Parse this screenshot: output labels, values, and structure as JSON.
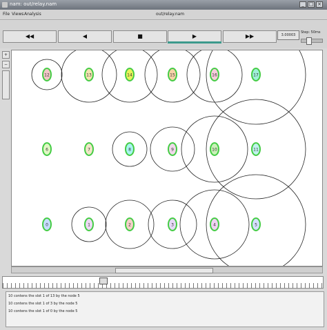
{
  "window": {
    "title": "nam: out/relay.nam"
  },
  "menu": {
    "items": [
      "File",
      "Views",
      "Analysis"
    ],
    "filename": "out/relay.nam"
  },
  "playback": {
    "buttons": [
      {
        "id": "rewind",
        "glyph": "◀◀"
      },
      {
        "id": "back",
        "glyph": "◀"
      },
      {
        "id": "stop",
        "glyph": "■"
      },
      {
        "id": "play",
        "glyph": "▶"
      },
      {
        "id": "forward",
        "glyph": "▶▶"
      }
    ],
    "time": "3.00003",
    "step_label": "Step: 50ms"
  },
  "colors": {
    "accent": "#3c9a8c",
    "canvas": "#ffffff"
  },
  "nodes": [
    {
      "label": "12",
      "fill": "#f2c6c6",
      "ring": "#44cc44"
    },
    {
      "label": "13",
      "fill": "#f3e4b0",
      "ring": "#44cc44"
    },
    {
      "label": "14",
      "fill": "#e8f25a",
      "ring": "#44cc44"
    },
    {
      "label": "15",
      "fill": "#f7d3a8",
      "ring": "#44cc44"
    },
    {
      "label": "16",
      "fill": "#f7cddc",
      "ring": "#44cc44"
    },
    {
      "label": "17",
      "fill": "#9ff0d8",
      "ring": "#44cc44"
    },
    {
      "label": "6",
      "fill": "#e0f7c4",
      "ring": "#44cc44"
    },
    {
      "label": "7",
      "fill": "#f0e6c8",
      "ring": "#44cc44"
    },
    {
      "label": "8",
      "fill": "#a8f4f0",
      "ring": "#44cc44"
    },
    {
      "label": "9",
      "fill": "#f0d8ea",
      "ring": "#44cc44"
    },
    {
      "label": "10",
      "fill": "#c9f1b8",
      "ring": "#44cc44"
    },
    {
      "label": "11",
      "fill": "#bff2ec",
      "ring": "#44cc44"
    },
    {
      "label": "0",
      "fill": "#c6dcff",
      "ring": "#44cc44"
    },
    {
      "label": "1",
      "fill": "#eed8f5",
      "ring": "#44cc44"
    },
    {
      "label": "2",
      "fill": "#f5d0c8",
      "ring": "#44cc44"
    },
    {
      "label": "3",
      "fill": "#e6d8f7",
      "ring": "#44cc44"
    },
    {
      "label": "4",
      "fill": "#f0d2f2",
      "ring": "#44cc44"
    },
    {
      "label": "5",
      "fill": "#d4e0ff",
      "ring": "#44cc44"
    }
  ],
  "log": [
    "10 contens the slot 1 of 13 by the node 5",
    "10 contens the slot 1 of 3 by the node 5",
    "10 contens the slot 1 of 0 by the node 5"
  ]
}
